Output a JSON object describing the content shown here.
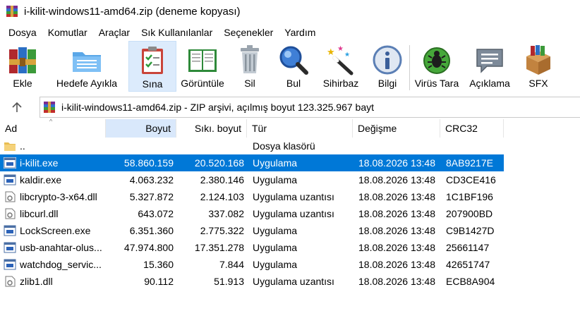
{
  "window": {
    "title": "i-kilit-windows11-amd64.zip (deneme kopyası)"
  },
  "menu": [
    "Dosya",
    "Komutlar",
    "Araçlar",
    "Sık Kullanılanlar",
    "Seçenekler",
    "Yardım"
  ],
  "toolbar": {
    "add": "Ekle",
    "extract": "Hedefe Ayıkla",
    "test": "Sına",
    "view": "Görüntüle",
    "delete": "Sil",
    "find": "Bul",
    "wizard": "Sihirbaz",
    "info": "Bilgi",
    "virus": "Virüs Tara",
    "comment": "Açıklama",
    "sfx": "SFX"
  },
  "address": {
    "text": "i-kilit-windows11-amd64.zip - ZIP arşivi, açılmış boyut 123.325.967 bayt"
  },
  "columns": {
    "name": "Ad",
    "size": "Boyut",
    "packed": "Sıkı. boyut",
    "type": "Tür",
    "modified": "Değişme",
    "crc": "CRC32"
  },
  "files": [
    {
      "name": "..",
      "size": "",
      "packed": "",
      "type": "Dosya klasörü",
      "modified": "",
      "crc": "",
      "icon": "folder-icon"
    },
    {
      "name": "i-kilit.exe",
      "size": "58.860.159",
      "packed": "20.520.168",
      "type": "Uygulama",
      "modified": "18.08.2026 13:48",
      "crc": "8AB9217E",
      "icon": "exe-icon",
      "selected": true
    },
    {
      "name": "kaldir.exe",
      "size": "4.063.232",
      "packed": "2.380.146",
      "type": "Uygulama",
      "modified": "18.08.2026 13:48",
      "crc": "CD3CE416",
      "icon": "exe-icon"
    },
    {
      "name": "libcrypto-3-x64.dll",
      "size": "5.327.872",
      "packed": "2.124.103",
      "type": "Uygulama uzantısı",
      "modified": "18.08.2026 13:48",
      "crc": "1C1BF196",
      "icon": "dll-icon"
    },
    {
      "name": "libcurl.dll",
      "size": "643.072",
      "packed": "337.082",
      "type": "Uygulama uzantısı",
      "modified": "18.08.2026 13:48",
      "crc": "207900BD",
      "icon": "dll-icon"
    },
    {
      "name": "LockScreen.exe",
      "size": "6.351.360",
      "packed": "2.775.322",
      "type": "Uygulama",
      "modified": "18.08.2026 13:48",
      "crc": "C9B1427D",
      "icon": "exe-icon"
    },
    {
      "name": "usb-anahtar-olus...",
      "size": "47.974.800",
      "packed": "17.351.278",
      "type": "Uygulama",
      "modified": "18.08.2026 13:48",
      "crc": "25661147",
      "icon": "exe-icon"
    },
    {
      "name": "watchdog_servic...",
      "size": "15.360",
      "packed": "7.844",
      "type": "Uygulama",
      "modified": "18.08.2026 13:48",
      "crc": "42651747",
      "icon": "exe-icon"
    },
    {
      "name": "zlib1.dll",
      "size": "90.112",
      "packed": "51.913",
      "type": "Uygulama uzantısı",
      "modified": "18.08.2026 13:48",
      "crc": "ECB8A904",
      "icon": "dll-icon"
    }
  ],
  "colors": {
    "selection": "#0078d7",
    "sorted_header": "#d9e8fb",
    "active_tool": "#dcebfc"
  }
}
